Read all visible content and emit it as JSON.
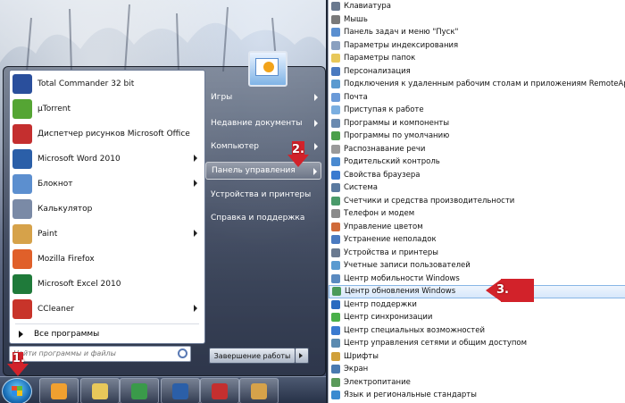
{
  "start_menu": {
    "programs": [
      {
        "label": "Total Commander 32 bit",
        "icon": "floppy-disk-icon",
        "color": "#2a4f9c",
        "arrow": false
      },
      {
        "label": "µTorrent",
        "icon": "utorrent-icon",
        "color": "#55a534",
        "arrow": false
      },
      {
        "label": "Диспетчер рисунков Microsoft Office",
        "icon": "picture-manager-icon",
        "color": "#c42f2f",
        "arrow": false
      },
      {
        "label": "Microsoft Word 2010",
        "icon": "word-icon",
        "color": "#2b5fa8",
        "arrow": true
      },
      {
        "label": "Блокнот",
        "icon": "notepad-icon",
        "color": "#5c8fcf",
        "arrow": true
      },
      {
        "label": "Калькулятор",
        "icon": "calculator-icon",
        "color": "#7a8aa6",
        "arrow": false
      },
      {
        "label": "Paint",
        "icon": "paint-palette-icon",
        "color": "#d6a24a",
        "arrow": true
      },
      {
        "label": "Mozilla Firefox",
        "icon": "firefox-icon",
        "color": "#e0602a",
        "arrow": false
      },
      {
        "label": "Microsoft Excel 2010",
        "icon": "excel-icon",
        "color": "#1f7a3a",
        "arrow": false
      },
      {
        "label": "CCleaner",
        "icon": "ccleaner-icon",
        "color": "#c8342a",
        "arrow": true
      }
    ],
    "all_programs": "Все программы",
    "search_placeholder": "Найти программы и файлы",
    "places": [
      {
        "label": "Игры",
        "arrow": true,
        "active": false
      },
      {
        "label": "Недавние документы",
        "arrow": true,
        "active": false
      },
      {
        "label": "Компьютер",
        "arrow": true,
        "active": false
      },
      {
        "label": "Панель управления",
        "arrow": true,
        "active": true
      },
      {
        "label": "Устройства и принтеры",
        "arrow": false,
        "active": false
      },
      {
        "label": "Справка и поддержка",
        "arrow": false,
        "active": false
      }
    ],
    "shutdown": "Завершение работы"
  },
  "taskbar": {
    "buttons": [
      {
        "icon": "media-player-icon",
        "color": "#f0a030"
      },
      {
        "icon": "explorer-folder-icon",
        "color": "#e8c85a"
      },
      {
        "icon": "chrome-icon",
        "color": "#3a9a4a"
      },
      {
        "icon": "word-icon",
        "color": "#2b5fa8"
      },
      {
        "icon": "picture-manager-icon",
        "color": "#c42f2f"
      },
      {
        "icon": "paint-palette-icon",
        "color": "#d6a24a"
      }
    ]
  },
  "annotations": {
    "step1": "1.",
    "step2": "2.",
    "step3": "3."
  },
  "control_panel": {
    "items": [
      {
        "label": "Клавиатура",
        "color": "#6b7a8f"
      },
      {
        "label": "Мышь",
        "color": "#7a7a7a"
      },
      {
        "label": "Панель задач и меню \"Пуск\"",
        "color": "#5a8fd0"
      },
      {
        "label": "Параметры индексирования",
        "color": "#8aa0c0"
      },
      {
        "label": "Параметры папок",
        "color": "#e8c85a"
      },
      {
        "label": "Персонализация",
        "color": "#4a7ac0"
      },
      {
        "label": "Подключения к удаленным рабочим столам и приложениям RemoteApp",
        "color": "#5a9ad0"
      },
      {
        "label": "Почта",
        "color": "#6a9ad8"
      },
      {
        "label": "Приступая к работе",
        "color": "#7aaee0"
      },
      {
        "label": "Программы и компоненты",
        "color": "#6a8ab0"
      },
      {
        "label": "Программы по умолчанию",
        "color": "#4aa04a"
      },
      {
        "label": "Распознавание речи",
        "color": "#9a9a9a"
      },
      {
        "label": "Родительский контроль",
        "color": "#4a8ad0"
      },
      {
        "label": "Свойства браузера",
        "color": "#3a7ad0"
      },
      {
        "label": "Система",
        "color": "#5a7aa0"
      },
      {
        "label": "Счетчики и средства производительности",
        "color": "#4a9a6a"
      },
      {
        "label": "Телефон и модем",
        "color": "#8a8a8a"
      },
      {
        "label": "Управление цветом",
        "color": "#d06a3a"
      },
      {
        "label": "Устранение неполадок",
        "color": "#4a7ac0"
      },
      {
        "label": "Устройства и принтеры",
        "color": "#6a7a90"
      },
      {
        "label": "Учетные записи пользователей",
        "color": "#5a9ad0"
      },
      {
        "label": "Центр мобильности Windows",
        "color": "#5a8ac0"
      },
      {
        "label": "Центр обновления Windows",
        "color": "#4a9a5a"
      },
      {
        "label": "Центр поддержки",
        "color": "#2a6ac0"
      },
      {
        "label": "Центр синхронизации",
        "color": "#4ab04a"
      },
      {
        "label": "Центр специальных возможностей",
        "color": "#3a7ad0"
      },
      {
        "label": "Центр управления сетями и общим доступом",
        "color": "#5a8ab0"
      },
      {
        "label": "Шрифты",
        "color": "#d0a03a"
      },
      {
        "label": "Экран",
        "color": "#4a7ab0"
      },
      {
        "label": "Электропитание",
        "color": "#5a9a5a"
      },
      {
        "label": "Язык и региональные стандарты",
        "color": "#3a8ad0"
      }
    ],
    "highlighted_index": 22
  }
}
